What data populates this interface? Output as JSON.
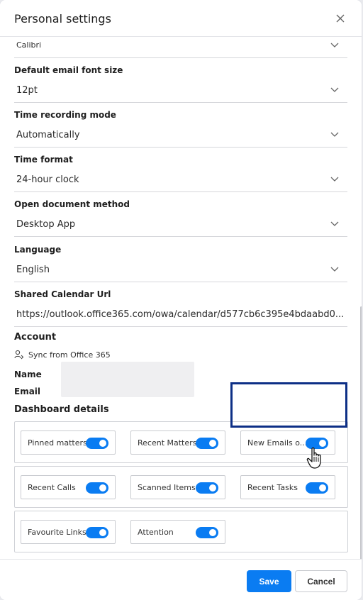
{
  "dialog": {
    "title": "Personal settings"
  },
  "fields": {
    "font_family": {
      "value": "Calibri"
    },
    "font_size": {
      "label": "Default email font size",
      "value": "12pt"
    },
    "time_recording": {
      "label": "Time recording mode",
      "value": "Automatically"
    },
    "time_format": {
      "label": "Time format",
      "value": "24-hour clock"
    },
    "open_document": {
      "label": "Open document method",
      "value": "Desktop App"
    },
    "language": {
      "label": "Language",
      "value": "English"
    },
    "calendar_url": {
      "label": "Shared Calendar Url",
      "value": "https://outlook.office365.com/owa/calendar/d577cb6c395e4bdaabd0..."
    }
  },
  "account": {
    "title": "Account",
    "sync_label": "Sync from Office 365",
    "name_label": "Name",
    "email_label": "Email"
  },
  "dashboard": {
    "title": "Dashboard details",
    "items": [
      {
        "label": "Pinned matters",
        "enabled": true
      },
      {
        "label": "Recent Matters",
        "enabled": true
      },
      {
        "label": "New Emails o...",
        "enabled": true
      },
      {
        "label": "Recent Calls",
        "enabled": true
      },
      {
        "label": "Scanned Items",
        "enabled": true
      },
      {
        "label": "Recent Tasks",
        "enabled": true
      },
      {
        "label": "Favourite Links",
        "enabled": true
      },
      {
        "label": "Attention",
        "enabled": true
      }
    ]
  },
  "footer": {
    "save_label": "Save",
    "cancel_label": "Cancel"
  },
  "colors": {
    "accent": "#0a7cf2",
    "highlight": "#0d2f86"
  },
  "icons": {
    "close": "close-icon",
    "chevron": "chevron-down-icon",
    "sync": "user-sync-icon",
    "cursor": "hand-pointer-icon"
  }
}
